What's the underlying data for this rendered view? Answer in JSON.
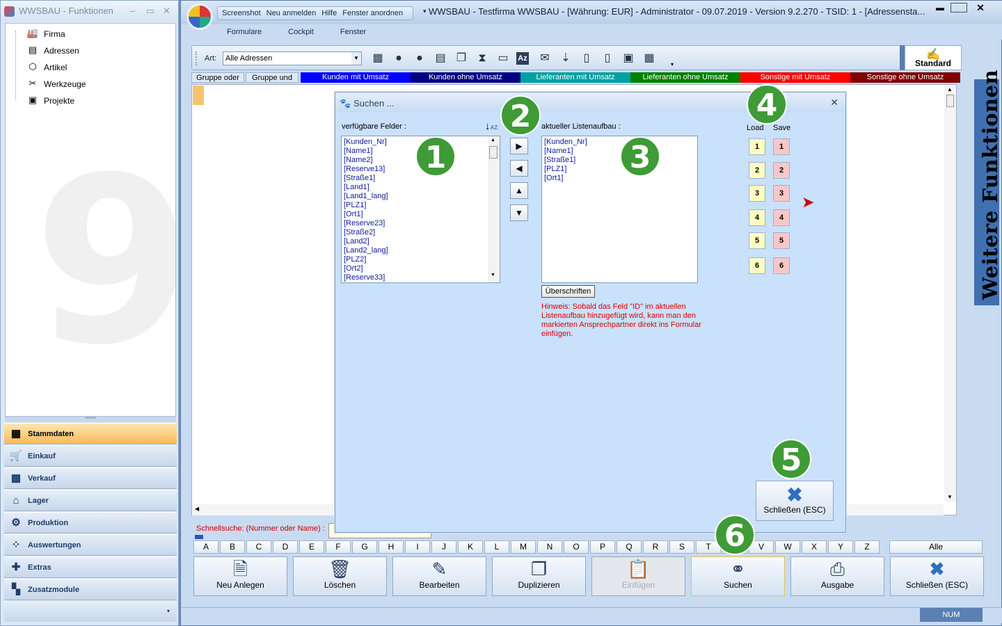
{
  "left_window": {
    "title": "WWSBAU - Funktionen",
    "tree": [
      {
        "label": "Firma",
        "icon": "factory-icon",
        "glyph": "🏭"
      },
      {
        "label": "Adressen",
        "icon": "address-icon",
        "glyph": "▤"
      },
      {
        "label": "Artikel",
        "icon": "box-icon",
        "glyph": "⬡"
      },
      {
        "label": "Werkzeuge",
        "icon": "tools-icon",
        "glyph": "✂"
      },
      {
        "label": "Projekte",
        "icon": "project-icon",
        "glyph": "▣"
      }
    ],
    "nav": [
      {
        "label": "Stammdaten",
        "icon": "stammdaten-icon",
        "glyph": "▦",
        "active": true
      },
      {
        "label": "Einkauf",
        "icon": "cart-icon",
        "glyph": "🛒"
      },
      {
        "label": "Verkauf",
        "icon": "register-icon",
        "glyph": "▩"
      },
      {
        "label": "Lager",
        "icon": "warehouse-icon",
        "glyph": "⌂"
      },
      {
        "label": "Produktion",
        "icon": "production-icon",
        "glyph": "⚙"
      },
      {
        "label": "Auswertungen",
        "icon": "chart-icon",
        "glyph": "⁘"
      },
      {
        "label": "Extras",
        "icon": "extras-icon",
        "glyph": "✚"
      },
      {
        "label": "Zusatzmodule",
        "icon": "modules-icon",
        "glyph": "▚"
      }
    ]
  },
  "main_window": {
    "quick_access": [
      "Screenshot",
      "Neu anmelden",
      "Hilfe",
      "Fenster anordnen"
    ],
    "caption": "WWSBAU - Testfirma WWSBAU - [Währung: EUR] - Administrator - 09.07.2019 - Version 9.2.270 - TSID: 1 - [Adressensta...",
    "menu": [
      "Formulare",
      "Cockpit",
      "Fenster"
    ],
    "toolbar": {
      "art_label": "Art:",
      "art_value": "Alle Adressen",
      "icons": [
        {
          "name": "calendar-icon",
          "glyph": "▦"
        },
        {
          "name": "person-icon",
          "glyph": "●"
        },
        {
          "name": "person2-icon",
          "glyph": "●"
        },
        {
          "name": "list-icon",
          "glyph": "▤"
        },
        {
          "name": "cards-icon",
          "glyph": "❐"
        },
        {
          "name": "hourglass-icon",
          "glyph": "⧗"
        },
        {
          "name": "card-icon",
          "glyph": "▭"
        },
        {
          "name": "sort-az-icon",
          "glyph": "Az"
        },
        {
          "name": "mail-icon",
          "glyph": "✉"
        },
        {
          "name": "sort-down-icon",
          "glyph": "⇣"
        },
        {
          "name": "page-icon",
          "glyph": "▯"
        },
        {
          "name": "page-header-icon",
          "glyph": "▯"
        },
        {
          "name": "screen-icon",
          "glyph": "▣"
        },
        {
          "name": "grid-icon",
          "glyph": "▦"
        }
      ],
      "standard_label": "Standard"
    },
    "filters": [
      {
        "label": "Gruppe oder",
        "bg": "#dfe9f5",
        "fg": "#000000"
      },
      {
        "label": "Gruppe und",
        "bg": "#dfe9f5",
        "fg": "#000000"
      },
      {
        "label": "Kunden mit Umsatz",
        "bg": "#0000ff",
        "fg": "#ffffff"
      },
      {
        "label": "Kunden ohne Umsatz",
        "bg": "#000080",
        "fg": "#ffffff"
      },
      {
        "label": "Lieferanten mit Umsatz",
        "bg": "#00a0a0",
        "fg": "#ffffff"
      },
      {
        "label": "Lieferanten ohne Umsatz",
        "bg": "#008000",
        "fg": "#ffffff"
      },
      {
        "label": "Sonstige mit Umsatz",
        "bg": "#ff0000",
        "fg": "#ffffff"
      },
      {
        "label": "Sonstige ohne Umsatz",
        "bg": "#800000",
        "fg": "#ffffff"
      }
    ],
    "weitere_funktionen": "Weitere Funktionen",
    "quick_search_label": "Schnellsuche: (Nummer oder Name) :",
    "letters": [
      "A",
      "B",
      "C",
      "D",
      "E",
      "F",
      "G",
      "H",
      "I",
      "J",
      "K",
      "L",
      "M",
      "N",
      "O",
      "P",
      "Q",
      "R",
      "S",
      "T",
      "U",
      "V",
      "W",
      "X",
      "Y",
      "Z"
    ],
    "all_label": "Alle",
    "buttons": [
      {
        "label": "Neu Anlegen",
        "icon": "new-document-icon",
        "glyph": "🗎",
        "state": "normal"
      },
      {
        "label": "Löschen",
        "icon": "trash-icon",
        "glyph": "🗑",
        "state": "normal"
      },
      {
        "label": "Bearbeiten",
        "icon": "edit-icon",
        "glyph": "✎",
        "state": "normal"
      },
      {
        "label": "Duplizieren",
        "icon": "duplicate-icon",
        "glyph": "❐",
        "state": "normal"
      },
      {
        "label": "Einfügen",
        "icon": "paste-icon",
        "glyph": "📋",
        "state": "disabled"
      },
      {
        "label": "Suchen",
        "icon": "binoculars-icon",
        "glyph": "⚭",
        "state": "highlight"
      },
      {
        "label": "Ausgabe",
        "icon": "printer-icon",
        "glyph": "⎙",
        "state": "normal"
      },
      {
        "label": "Schließen (ESC)",
        "icon": "close-x-icon",
        "glyph": "✖",
        "state": "normal"
      }
    ],
    "status_num": "NUM"
  },
  "dialog": {
    "title": "Suchen ...",
    "available_label": "verfügbare Felder :",
    "available_fields": [
      "[Kunden_Nr]",
      "[Name1]",
      "[Name2]",
      "[Reserve13]",
      "[Straße1]",
      "[Land1]",
      "[Land1_lang]",
      "[PLZ1]",
      "[Ort1]",
      "[Reserve23]",
      "[Straße2]",
      "[Land2]",
      "[Land2_lang]",
      "[PLZ2]",
      "[Ort2]",
      "[Reserve33]"
    ],
    "current_label": "aktueller Listenaufbau :",
    "current_fields": [
      "[Kunden_Nr]",
      "[Name1]",
      "[Straße1]",
      "[PLZ1]",
      "[Ort1]"
    ],
    "ueberschriften": "Überschriften",
    "hint": "Hinweis: Sobald das Feld \"ID\" im aktuellen Listenaufbau hinzugefügt wird, kann man den markierten Ansprechpartner direkt ins Formular einfügen.",
    "load_label": "Load",
    "save_label": "Save",
    "slots": [
      "1",
      "2",
      "3",
      "4",
      "5",
      "6"
    ],
    "close_label": "Schließen (ESC)"
  },
  "badges": [
    "1",
    "2",
    "3",
    "4",
    "5",
    "6"
  ]
}
